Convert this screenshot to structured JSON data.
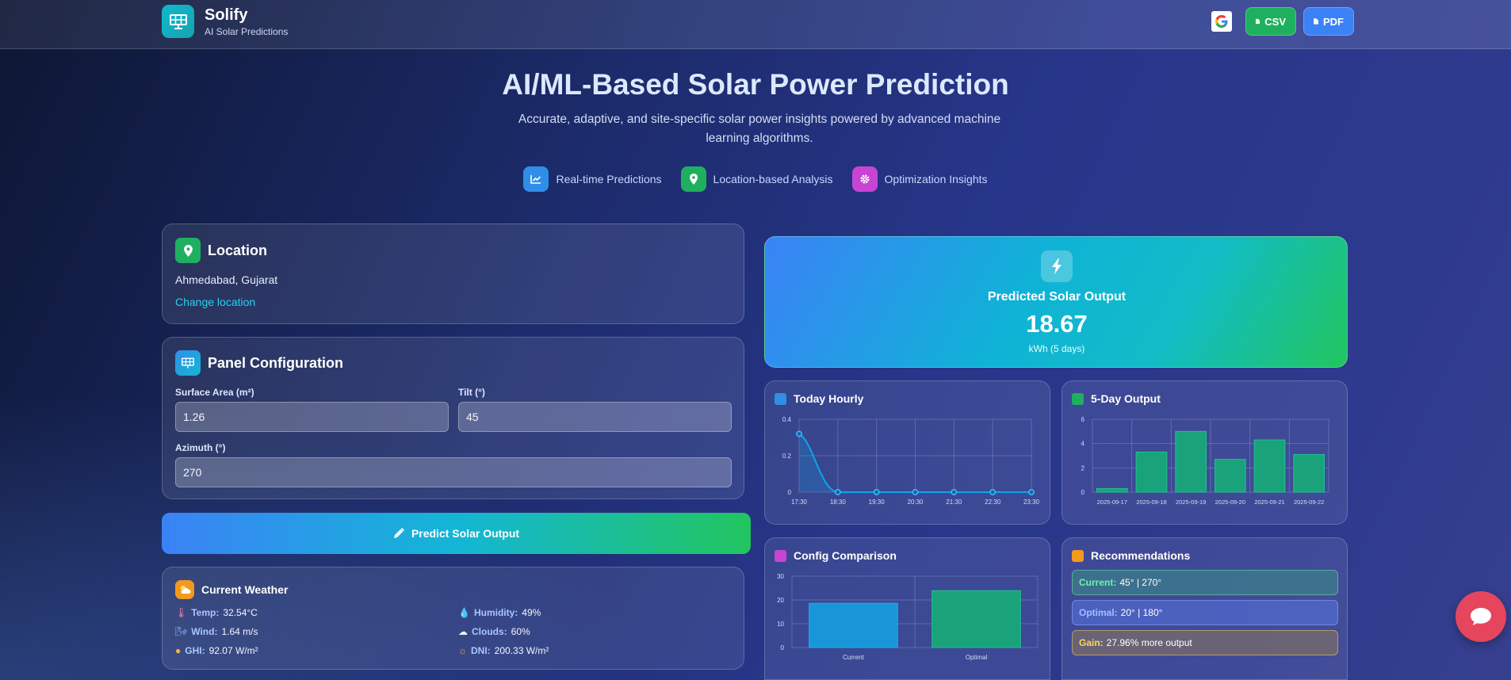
{
  "brand": {
    "name": "Solify",
    "tagline": "AI Solar Predictions"
  },
  "header_actions": {
    "csv_label": "CSV",
    "pdf_label": "PDF"
  },
  "hero": {
    "title": "AI/ML-Based Solar Power Prediction",
    "subtitle": "Accurate, adaptive, and site-specific solar power insights powered by advanced machine learning algorithms.",
    "features": [
      {
        "label": "Real-time Predictions",
        "icon": "chart-line-icon",
        "color": "#2f8fe8"
      },
      {
        "label": "Location-based Analysis",
        "icon": "map-pin-icon",
        "color": "#1fb05f"
      },
      {
        "label": "Optimization Insights",
        "icon": "gear-icon",
        "color": "#c845d3"
      }
    ]
  },
  "location": {
    "title": "Location",
    "value": "Ahmedabad, Gujarat",
    "change_link": "Change location"
  },
  "panel": {
    "title": "Panel Configuration",
    "surface_area_label": "Surface Area (m²)",
    "surface_area_value": "1.26",
    "tilt_label": "Tilt (°)",
    "tilt_value": "45",
    "azimuth_label": "Azimuth (°)",
    "azimuth_value": "270"
  },
  "predict_button": "Predict Solar Output",
  "weather": {
    "title": "Current Weather",
    "temp_key": "Temp:",
    "temp_val": "32.54°C",
    "humidity_key": "Humidity:",
    "humidity_val": "49%",
    "wind_key": "Wind:",
    "wind_val": "1.64 m/s",
    "clouds_key": "Clouds:",
    "clouds_val": "60%",
    "ghi_key": "GHI:",
    "ghi_val": "92.07 W/m²",
    "dni_key": "DNI:",
    "dni_val": "200.33 W/m²"
  },
  "prediction": {
    "label": "Predicted Solar Output",
    "value": "18.67",
    "unit": "kWh (5 days)"
  },
  "cards": {
    "hourly_title": "Today Hourly",
    "five_day_title": "5-Day Output",
    "config_title": "Config Comparison",
    "rec_title": "Recommendations"
  },
  "recommendations": {
    "current_key": "Current:",
    "current_val": "45° | 270°",
    "optimal_key": "Optimal:",
    "optimal_val": "20° | 180°",
    "gain_key": "Gain:",
    "gain_val": "27.96% more output"
  },
  "colors": {
    "accent_blue": "#3b82f6",
    "accent_green": "#22c55e",
    "teal": "#14b8a6",
    "sky": "#0ea5e9"
  },
  "chart_data": [
    {
      "type": "line",
      "title": "Today Hourly",
      "x": [
        "17:30",
        "18:30",
        "19:30",
        "20:30",
        "21:30",
        "22:30",
        "23:30"
      ],
      "series": [
        {
          "values": [
            0.32,
            0.0,
            0.0,
            0.0,
            0.0,
            0.0,
            0.0
          ]
        }
      ],
      "yticks": [
        "0",
        "0.2",
        "0.4"
      ],
      "ylim": [
        0,
        0.4
      ],
      "grid": true
    },
    {
      "type": "bar",
      "title": "5-Day Output",
      "categories": [
        "2025-09-17",
        "2025-09-18",
        "2025-09-19",
        "2025-09-20",
        "2025-09-21",
        "2025-09-22"
      ],
      "values": [
        0.3,
        3.3,
        5.0,
        2.7,
        4.3,
        3.1
      ],
      "yticks": [
        "0",
        "2",
        "4",
        "6"
      ],
      "ylim": [
        0,
        6
      ],
      "grid": true
    },
    {
      "type": "bar",
      "title": "Config Comparison",
      "categories": [
        "Current",
        "Optimal"
      ],
      "values": [
        18.6,
        23.9
      ],
      "yticks": [
        "0",
        "10",
        "20",
        "30"
      ],
      "ylim": [
        0,
        30
      ],
      "grid": true
    }
  ]
}
